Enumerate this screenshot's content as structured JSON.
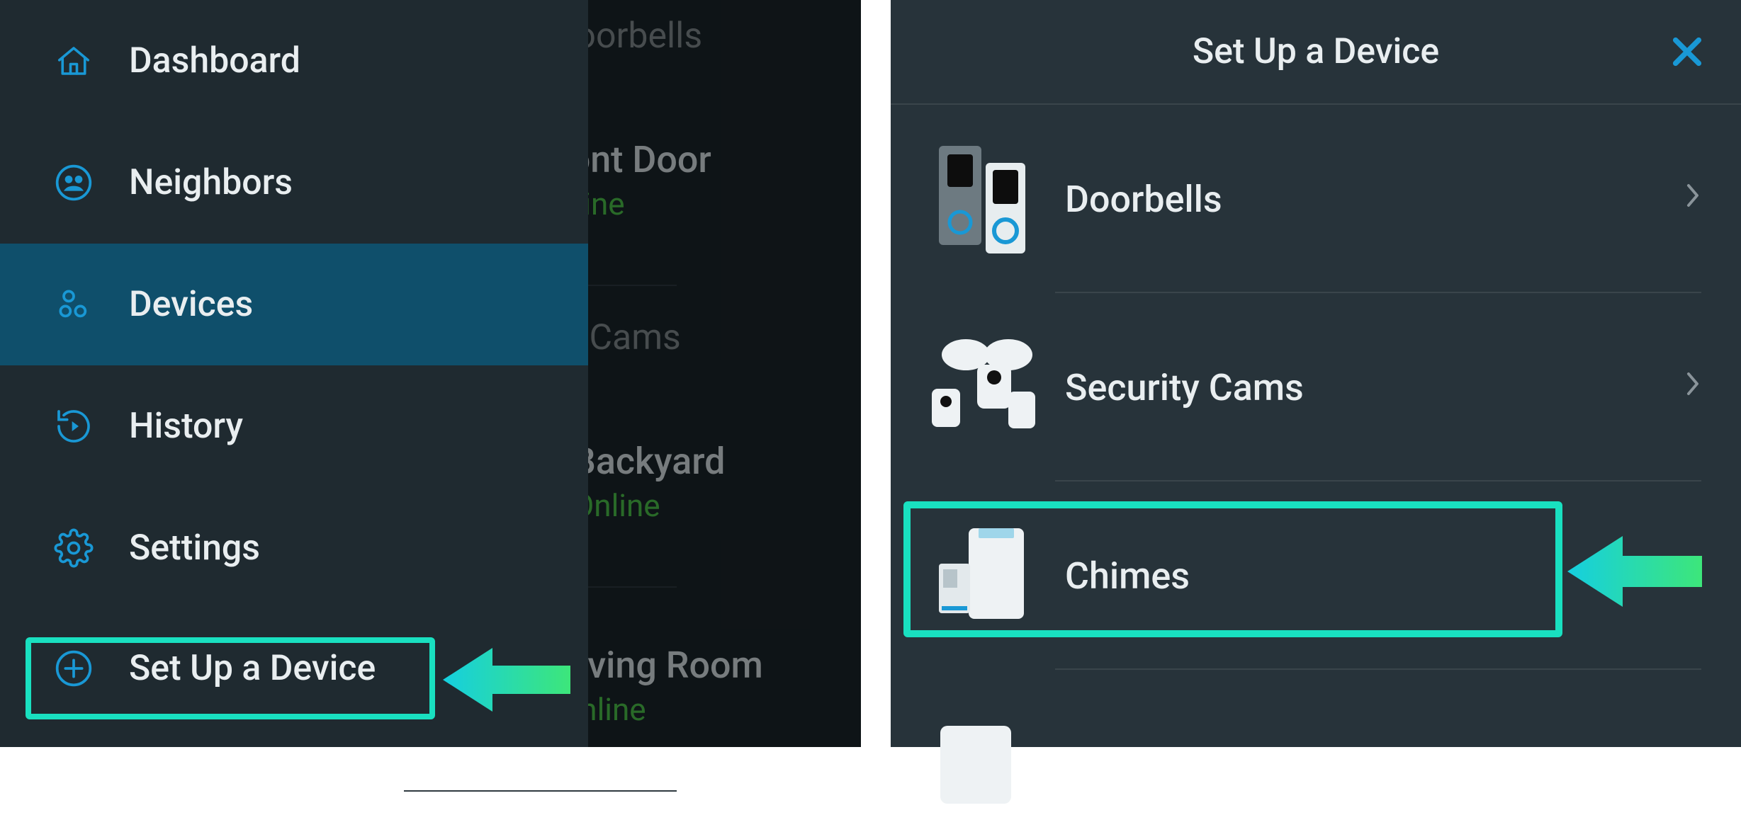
{
  "colors": {
    "accent": "#1998d5",
    "highlight": "#19e0c0",
    "arrow_start": "#15cfe0",
    "arrow_end": "#3de67a",
    "online": "#4cc24a"
  },
  "sidebar": {
    "items": [
      {
        "label": "Dashboard",
        "icon": "home-icon",
        "selected": false
      },
      {
        "label": "Neighbors",
        "icon": "neighbors-icon",
        "selected": false
      },
      {
        "label": "Devices",
        "icon": "devices-icon",
        "selected": true
      },
      {
        "label": "History",
        "icon": "history-icon",
        "selected": false
      },
      {
        "label": "Settings",
        "icon": "gear-icon",
        "selected": false
      },
      {
        "label": "Set Up a Device",
        "icon": "plus-circle-icon",
        "selected": false
      }
    ]
  },
  "background": {
    "section1_title": "Video Doorbells",
    "section2_title": "Security Cams",
    "devices": [
      {
        "name": "Front Door",
        "status": "Online"
      },
      {
        "name": "Backyard",
        "status": "Online"
      },
      {
        "name": "Living Room",
        "status": "Online"
      }
    ]
  },
  "setup": {
    "title": "Set Up a Device",
    "categories": [
      {
        "label": "Doorbells"
      },
      {
        "label": "Security Cams"
      },
      {
        "label": "Chimes"
      }
    ]
  }
}
